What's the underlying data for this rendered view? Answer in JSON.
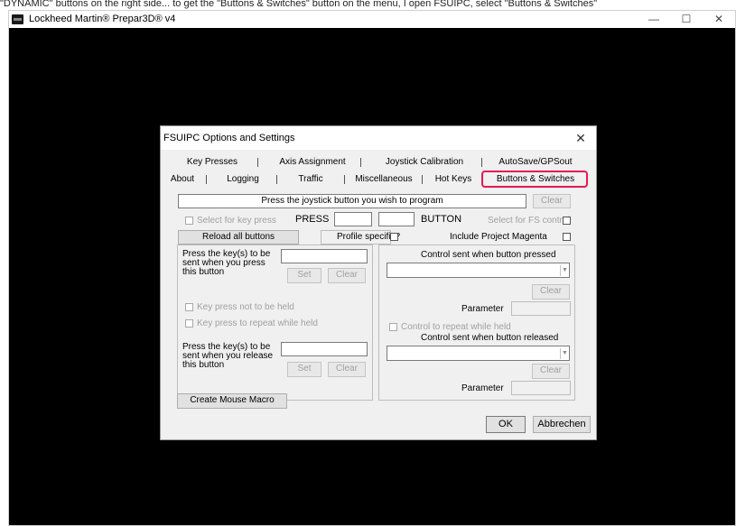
{
  "page_band_text": "\"DYNAMIC\" buttons on the right side... to get the \"Buttons & Switches\" button on the menu, I open FSUIPC, select \"Buttons & Switches\"",
  "app": {
    "title": "Lockheed Martin® Prepar3D® v4",
    "controls": {
      "minimize": "—",
      "maximize": "☐",
      "close": "✕"
    }
  },
  "dialog": {
    "title": "FSUIPC Options and Settings",
    "close": "✕",
    "tabs_row1": [
      "Key Presses",
      "Axis Assignment",
      "Joystick Calibration",
      "AutoSave/GPSout"
    ],
    "tabs_row2": [
      "About",
      "Logging",
      "Traffic",
      "Miscellaneous",
      "Hot Keys",
      "Buttons & Switches"
    ],
    "active_tab": "Buttons & Switches",
    "highlight_color": "#e8174f",
    "prompt": "Press the joystick button you wish to program",
    "clear_top": "Clear",
    "select_key_press": "Select for key press",
    "press_label": "PRESS",
    "button_label": "BUTTON",
    "select_fs_control": "Select for FS control",
    "reload_all": "Reload all buttons",
    "profile_specific": "Profile specific?",
    "include_project_magenta": "Include Project Magenta",
    "left_group": {
      "press_keys_label": "Press the key(s) to be sent when you press this button",
      "set": "Set",
      "clear": "Clear",
      "not_held": "Key press not to be held",
      "repeat_held": "Key press to repeat while held",
      "release_keys_label": "Press the key(s) to be sent when you release this button",
      "set2": "Set",
      "clear2": "Clear",
      "mouse_macro": "Create Mouse Macro"
    },
    "right_group": {
      "pressed_title": "Control sent when button pressed",
      "clear": "Clear",
      "parameter": "Parameter",
      "repeat_held": "Control to repeat while held",
      "released_title": "Control sent when button released",
      "clear2": "Clear",
      "parameter2": "Parameter",
      "combo_arrow": "▼"
    },
    "ok": "OK",
    "cancel": "Abbrechen"
  }
}
